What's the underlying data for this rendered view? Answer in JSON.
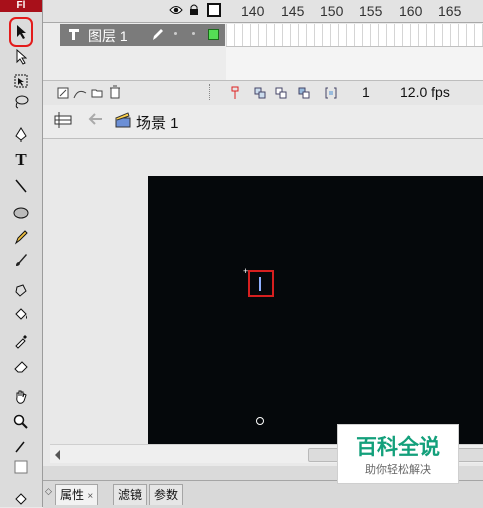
{
  "app": {
    "badge": "Fl"
  },
  "timeline": {
    "frame_numbers": [
      "140",
      "145",
      "150",
      "155",
      "160",
      "165"
    ],
    "layer": {
      "name": "图层 1"
    },
    "status": {
      "current_frame": "1",
      "frame_rate": "12.0 fps"
    }
  },
  "edit_bar": {
    "scene": "场景 1"
  },
  "panels": {
    "tabs": [
      {
        "label": "属性"
      },
      {
        "label": "滤镜"
      },
      {
        "label": "参数"
      }
    ]
  },
  "watermark": {
    "title": "百科全说",
    "subtitle": "助你轻松解决"
  },
  "colors": {
    "stage": "#05080b",
    "highlight": "#e31b1b",
    "brand": "#a8101a",
    "layer_swatch": "#55dd55"
  }
}
